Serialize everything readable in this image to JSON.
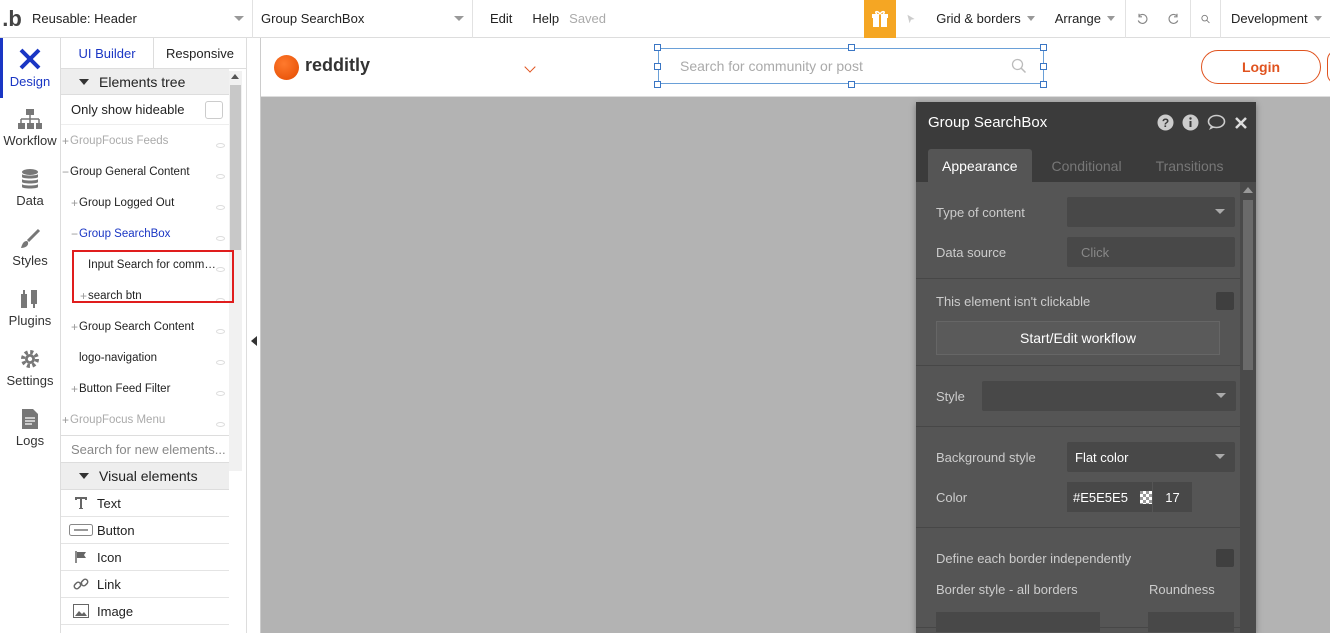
{
  "topbar": {
    "logo": ".b",
    "page_select": "Reusable: Header",
    "element_select": "Group SearchBox",
    "edit": "Edit",
    "help": "Help",
    "saved": "Saved",
    "grid": "Grid & borders",
    "arrange": "Arrange",
    "env": "Development"
  },
  "leftnav": [
    {
      "label": "Design",
      "icon": "design-icon"
    },
    {
      "label": "Workflow",
      "icon": "workflow-icon"
    },
    {
      "label": "Data",
      "icon": "database-icon"
    },
    {
      "label": "Styles",
      "icon": "brush-icon"
    },
    {
      "label": "Plugins",
      "icon": "plug-icon"
    },
    {
      "label": "Settings",
      "icon": "gear-icon"
    },
    {
      "label": "Logs",
      "icon": "document-icon"
    }
  ],
  "panel": {
    "tab_ui": "UI Builder",
    "tab_responsive": "Responsive",
    "elements_tree": "Elements tree",
    "only_show": "Only show hideable",
    "tree": [
      {
        "label": "GroupFocus Feeds",
        "prefix": "+",
        "indent": 0
      },
      {
        "label": "Group General Content",
        "prefix": "−",
        "indent": 0
      },
      {
        "label": "Group Logged Out",
        "prefix": "+",
        "indent": 1
      },
      {
        "label": "Group SearchBox",
        "prefix": "−",
        "indent": 1
      },
      {
        "label": "Input Search for comm…",
        "prefix": "",
        "indent": 2
      },
      {
        "label": "search btn",
        "prefix": "+",
        "indent": 2
      },
      {
        "label": "Group Search Content",
        "prefix": "+",
        "indent": 1
      },
      {
        "label": "logo-navigation",
        "prefix": "",
        "indent": 1
      },
      {
        "label": "Button Feed Filter",
        "prefix": "+",
        "indent": 1
      },
      {
        "label": "GroupFocus Menu",
        "prefix": "+",
        "indent": 0
      }
    ],
    "search_placeholder": "Search for new elements...",
    "visual_elements": "Visual elements",
    "visual": [
      {
        "label": "Text",
        "icon": "text-icon"
      },
      {
        "label": "Button",
        "icon": "button-icon"
      },
      {
        "label": "Icon",
        "icon": "flag-icon"
      },
      {
        "label": "Link",
        "icon": "link-icon"
      },
      {
        "label": "Image",
        "icon": "image-icon"
      }
    ]
  },
  "canvas": {
    "brand": "redditly",
    "search_placeholder": "Search for community or post",
    "login": "Login"
  },
  "editor": {
    "title": "Group SearchBox",
    "tabs": [
      "Appearance",
      "Conditional",
      "Transitions"
    ],
    "type_of_content": "Type of content",
    "data_source": "Data source",
    "data_source_value": "Click",
    "not_clickable": "This element isn't clickable",
    "workflow_btn": "Start/Edit workflow",
    "style": "Style",
    "bg_style": "Background style",
    "bg_style_value": "Flat color",
    "color": "Color",
    "color_value": "#E5E5E5",
    "opacity_value": "17",
    "define_border": "Define each border independently",
    "border_style": "Border style - all borders",
    "roundness": "Roundness"
  },
  "colors": {
    "accent": "#1a36c4",
    "brand": "#e0531f",
    "highlight": "#e01d1d"
  }
}
